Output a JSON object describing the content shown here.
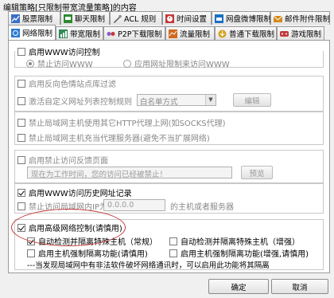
{
  "window": {
    "title": "编辑策略[只限制带宽流量策略]的内容"
  },
  "tabs_row1": [
    {
      "label": "股票限制",
      "icon": "stock-icon",
      "color": "#3a6fc4"
    },
    {
      "label": "聊天限制",
      "icon": "chat-icon",
      "color": "#2f8a2f"
    },
    {
      "label": "ACL 规则",
      "icon": "acl-icon",
      "color": "#555555"
    },
    {
      "label": "时间设置",
      "icon": "clock-icon",
      "color": "#c23a3a"
    },
    {
      "label": "网盘微博限制",
      "icon": "cloud-disk-icon",
      "color": "#1c6fc2"
    },
    {
      "label": "邮件附件限制",
      "icon": "mail-icon",
      "color": "#d28a1c"
    }
  ],
  "tabs_row2": [
    {
      "label": "网络限制",
      "icon": "network-icon",
      "color": "#2a7ad1",
      "active": true
    },
    {
      "label": "带宽限制",
      "icon": "bandwidth-icon",
      "color": "#2e8b57",
      "active": false
    },
    {
      "label": "P2P下载限制",
      "icon": "p2p-icon",
      "color": "#8a5cc4",
      "active": false
    },
    {
      "label": "流量限制",
      "icon": "traffic-icon",
      "color": "#d2691e",
      "active": false
    },
    {
      "label": "普通下载限制",
      "icon": "download-icon",
      "color": "#d2a21e",
      "active": false
    },
    {
      "label": "游戏限制",
      "icon": "game-icon",
      "color": "#c23a3a",
      "active": false
    }
  ],
  "www": {
    "enable_label": "启用WWW访问控制",
    "enabled": false,
    "radio_forbid": "禁止访问WWW",
    "radio_allow": "应用网址限制来访问WWW"
  },
  "url_filter": {
    "reverse_proxy_label": "启用反向色情站点库过滤",
    "custom_rule_label": "激活自定义网址列表控制规则",
    "list_mode": "白名单方式",
    "edit_button": "编辑"
  },
  "proxy": {
    "http_proxy_label": "禁止局域网主机使用其它HTTP代理上网(如SOCKS代理)",
    "act_as_proxy_label": "禁止局域网主机充当代理服务器(避免不当扩展网络)"
  },
  "feedback": {
    "enable_label": "启用禁止访问反馈页面",
    "message": "现在为工作时间，您的访问已经被禁止！",
    "preview_button": "预览"
  },
  "history": {
    "enable_label": "启用WWW访问历史网址记录",
    "enabled": true,
    "forbid_ip_label": "禁止访问局域网内IP为",
    "ip_placeholder": "0.0.0.0",
    "ip_suffix": "的主机或者服务器"
  },
  "advanced": {
    "enable_label": "启用高级网络控制(请慎用)",
    "enabled": true,
    "auto_detect_normal": "自动检测并隔离特殊主机（常规）",
    "auto_detect_normal_checked": true,
    "auto_detect_enhanced": "自动检测并隔离特殊主机（增强）",
    "auto_detect_enhanced_checked": false,
    "force_isolate_normal": "启用主机强制隔离功能(请慎用)",
    "force_isolate_enhanced": "启用主机强制隔离功能(增强,请慎用)",
    "note": "---当发现局域网中有非法软件破坏网络通讯时，可以启用此功能将其隔离"
  },
  "footer": {
    "ok_button": "确定",
    "cancel_button": "取消"
  }
}
